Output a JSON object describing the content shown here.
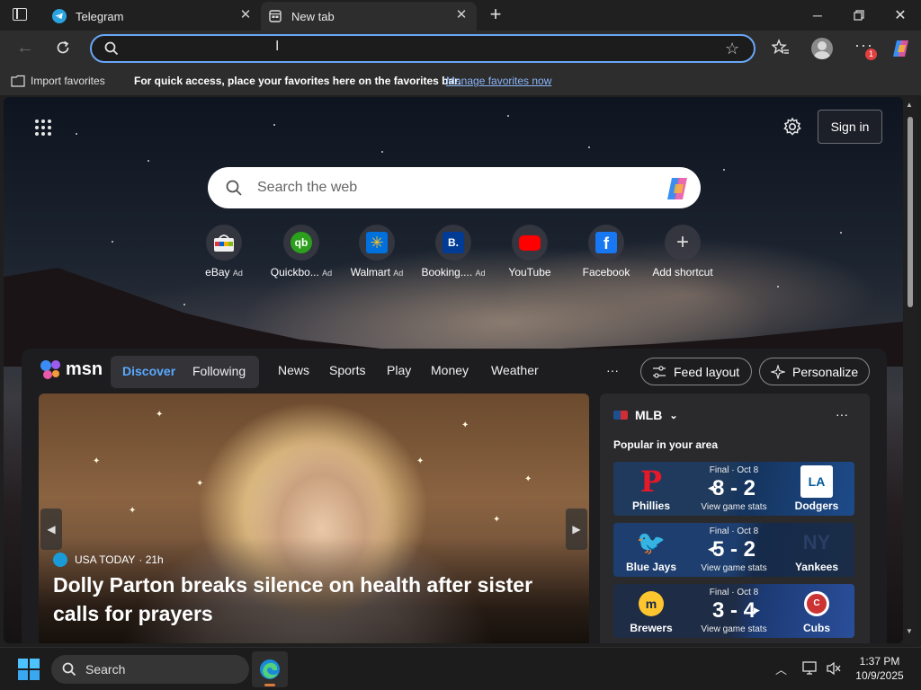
{
  "tabs": [
    {
      "title": "Telegram"
    },
    {
      "title": "New tab"
    }
  ],
  "address": {
    "value": "",
    "placeholder": ""
  },
  "toolbar": {
    "notification_count": "1"
  },
  "favbar": {
    "import_label": "Import favorites",
    "message": "For quick access, place your favorites here on the favorites bar.",
    "manage_link": "Manage favorites now"
  },
  "newtab": {
    "signin_label": "Sign in",
    "search_placeholder": "Search the web",
    "shortcuts": [
      {
        "label": "eBay",
        "ad": "Ad"
      },
      {
        "label": "Quickbo...",
        "ad": "Ad"
      },
      {
        "label": "Walmart",
        "ad": "Ad"
      },
      {
        "label": "Booking....",
        "ad": "Ad"
      },
      {
        "label": "YouTube",
        "ad": ""
      },
      {
        "label": "Facebook",
        "ad": ""
      },
      {
        "label": "Add shortcut",
        "ad": ""
      }
    ]
  },
  "msn": {
    "logo_text": "msn",
    "tabs": [
      "Discover",
      "Following"
    ],
    "nav": [
      "News",
      "Sports",
      "Play",
      "Money",
      "Weather"
    ],
    "more": "···",
    "feed_layout": "Feed layout",
    "personalize": "Personalize",
    "hero": {
      "source": "USA TODAY",
      "age": "· 21h",
      "headline": "Dolly Parton breaks silence on health after sister calls for prayers"
    },
    "mlb": {
      "title": "MLB",
      "subtitle": "Popular in your area",
      "more": "···",
      "games": [
        {
          "status": "Final · Oct 8",
          "score": "8 - 2",
          "stats": "View game stats",
          "home": "Phillies",
          "away": "Dodgers",
          "winner": "left"
        },
        {
          "status": "Final · Oct 8",
          "score": "5 - 2",
          "stats": "View game stats",
          "home": "Blue Jays",
          "away": "Yankees",
          "winner": "left"
        },
        {
          "status": "Final · Oct 8",
          "score": "3 - 4",
          "stats": "View game stats",
          "home": "Brewers",
          "away": "Cubs",
          "winner": "right"
        }
      ]
    }
  },
  "taskbar": {
    "search_label": "Search",
    "time": "1:37 PM",
    "date": "10/9/2025"
  },
  "colors": {
    "accent": "#6aa6f7",
    "link": "#8ab4f8",
    "msn_active": "#5aa9ff"
  }
}
